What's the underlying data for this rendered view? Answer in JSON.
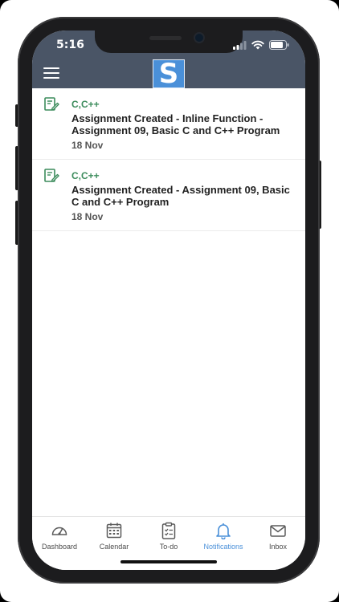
{
  "status_bar": {
    "time": "5:16"
  },
  "header": {
    "logo_letter": "S"
  },
  "notifications": [
    {
      "course": "C,C++",
      "title": "Assignment Created - Inline Function - Assignment 09, Basic C and C++ Program",
      "date": "18 Nov",
      "icon": "edit-assignment-icon"
    },
    {
      "course": "C,C++",
      "title": "Assignment Created - Assignment 09, Basic C and C++ Program",
      "date": "18 Nov",
      "icon": "edit-assignment-icon"
    }
  ],
  "tabbar": {
    "tabs": [
      {
        "label": "Dashboard",
        "icon": "dashboard-gauge-icon"
      },
      {
        "label": "Calendar",
        "icon": "calendar-icon"
      },
      {
        "label": "To-do",
        "icon": "clipboard-icon"
      },
      {
        "label": "Notifications",
        "icon": "bell-icon",
        "active": true
      },
      {
        "label": "Inbox",
        "icon": "envelope-icon"
      }
    ]
  },
  "colors": {
    "header_bg": "#4a5566",
    "accent": "#4a90d9",
    "course_green": "#3c8c5c"
  }
}
